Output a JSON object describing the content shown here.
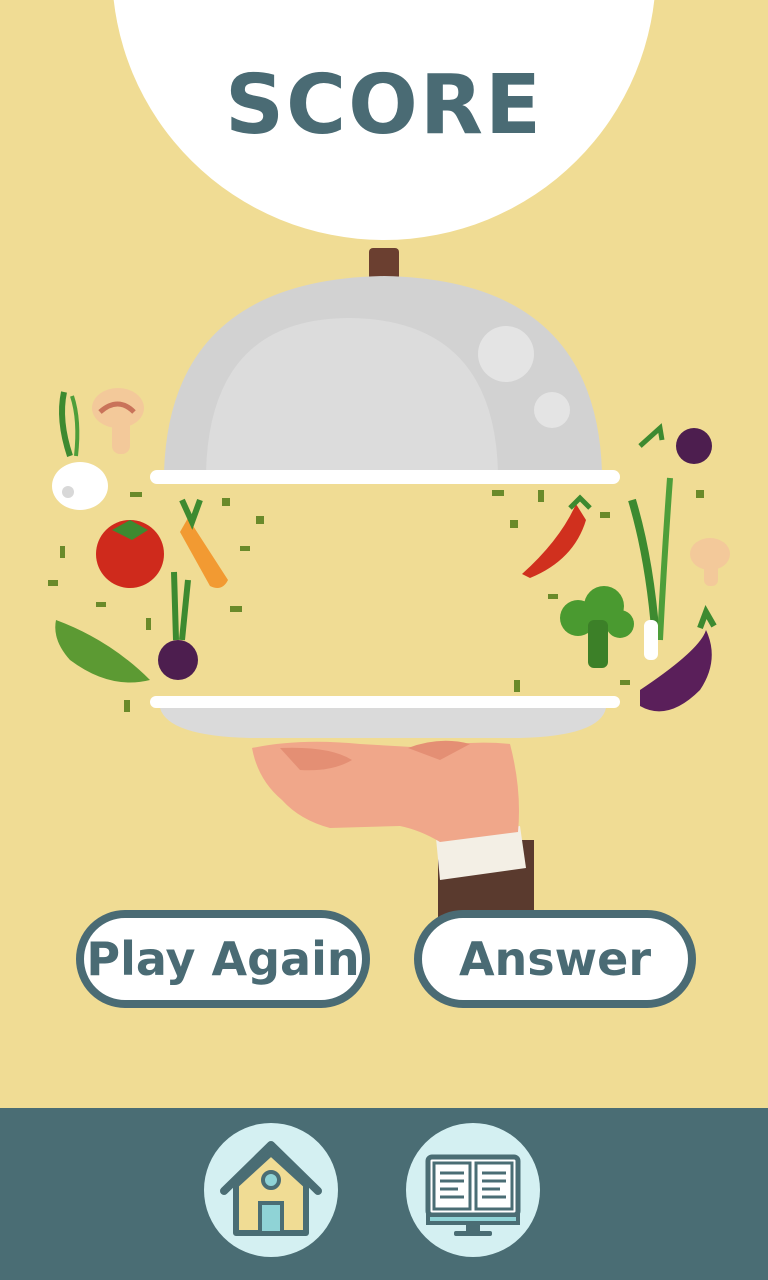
{
  "header": {
    "title": "SCORE"
  },
  "buttons": {
    "play_again": "Play Again",
    "answer": "Answer"
  },
  "nav": {
    "home_icon": "home-icon",
    "book_icon": "book-computer-icon"
  },
  "colors": {
    "background": "#f0dc94",
    "accent": "#4a6b74",
    "bottom_bar": "#4a6d74",
    "nav_button": "#d4f0f2",
    "button_fill": "#ffffff"
  }
}
